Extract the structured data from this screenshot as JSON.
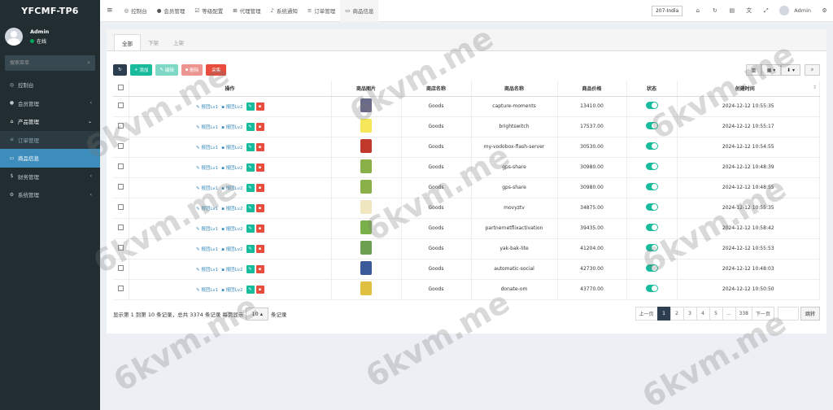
{
  "brand": "YFCMF-TP6",
  "user": {
    "name": "Admin",
    "status": "在线"
  },
  "sidebar": {
    "search_placeholder": "搜索菜单",
    "items": [
      {
        "label": "控制台",
        "icon": "dashboard-icon",
        "glyph": "◎",
        "type": "normal"
      },
      {
        "label": "会员管理",
        "icon": "user-icon",
        "glyph": "●",
        "type": "normal",
        "arrow": "‹"
      },
      {
        "label": "产品管理",
        "icon": "home-icon",
        "glyph": "⌂",
        "type": "open",
        "arrow": "⌄"
      },
      {
        "label": "订单管理",
        "icon": "list-icon",
        "glyph": "≡",
        "type": "sub"
      },
      {
        "label": "商品信息",
        "icon": "monitor-icon",
        "glyph": "▭",
        "type": "active"
      },
      {
        "label": "财务管理",
        "icon": "money-icon",
        "glyph": "$",
        "type": "normal",
        "arrow": "‹"
      },
      {
        "label": "系统管理",
        "icon": "cogs-icon",
        "glyph": "⚙",
        "type": "normal",
        "arrow": "‹"
      }
    ]
  },
  "topbar": {
    "items": [
      {
        "label": "控制台",
        "icon": "dashboard-icon",
        "glyph": "◎"
      },
      {
        "label": "会员管理",
        "icon": "user-icon",
        "glyph": "●"
      },
      {
        "label": "等级配置",
        "icon": "check-square-icon",
        "glyph": "☑"
      },
      {
        "label": "代理管理",
        "icon": "sitemap-icon",
        "glyph": "⊞"
      },
      {
        "label": "系统通知",
        "icon": "bell-icon",
        "glyph": "♪"
      },
      {
        "label": "订单管理",
        "icon": "list-icon",
        "glyph": "≡"
      },
      {
        "label": "商品信息",
        "icon": "monitor-icon",
        "glyph": "▭"
      }
    ],
    "region": "207-India",
    "user": "Admin"
  },
  "tabs": [
    "全部",
    "下架",
    "上架"
  ],
  "toolbar": {
    "add": "添加",
    "edit": "编辑",
    "delete": "删除",
    "collect": "采集"
  },
  "table": {
    "headers": [
      "操作",
      "商品图片",
      "商店名称",
      "商品名称",
      "商品价格",
      "状态",
      "创建时间"
    ],
    "op_lv1": "报团Lv1",
    "op_lv2": "报团Lv2",
    "rows": [
      {
        "shop": "Goods",
        "name": "capture-moments",
        "price": "13410.00",
        "time": "2024-12-12 10:55:35",
        "thumb": "#6a6a8a"
      },
      {
        "shop": "Goods",
        "name": "brightswitch",
        "price": "17537.00",
        "time": "2024-12-12 10:55:17",
        "thumb": "#f5e65a"
      },
      {
        "shop": "Goods",
        "name": "my-vodobox-flash-server",
        "price": "30530.00",
        "time": "2024-12-12 10:54:55",
        "thumb": "#c0392b"
      },
      {
        "shop": "Goods",
        "name": "gps-share",
        "price": "30980.00",
        "time": "2024-12-12 10:48:39",
        "thumb": "#8ab04a"
      },
      {
        "shop": "Goods",
        "name": "gps-share",
        "price": "30980.00",
        "time": "2024-12-12 10:48:55",
        "thumb": "#8ab04a"
      },
      {
        "shop": "Goods",
        "name": "movyztv",
        "price": "34875.00",
        "time": "2024-12-12 10:55:35",
        "thumb": "#f0e6c0"
      },
      {
        "shop": "Goods",
        "name": "partnernetflixactivation",
        "price": "39435.00",
        "time": "2024-12-12 10:58:42",
        "thumb": "#7ab04a"
      },
      {
        "shop": "Goods",
        "name": "yak-bak-lite",
        "price": "41204.00",
        "time": "2024-12-12 10:55:53",
        "thumb": "#6aa050"
      },
      {
        "shop": "Goods",
        "name": "automatic-social",
        "price": "42730.00",
        "time": "2024-12-12 10:48:03",
        "thumb": "#3a5a9a"
      },
      {
        "shop": "Goods",
        "name": "donate-om",
        "price": "43770.00",
        "time": "2024-12-12 10:50:50",
        "thumb": "#e0c040"
      }
    ]
  },
  "footer": {
    "summary": "显示第 1 到第 10 条记录，总共 3374 条记录 每页显示",
    "page_size": "10 ▴",
    "suffix": "条记录",
    "pages": [
      "上一页",
      "1",
      "2",
      "3",
      "4",
      "5",
      "...",
      "338",
      "下一页"
    ],
    "jump": "跳转"
  },
  "watermark": "6kvm.me"
}
